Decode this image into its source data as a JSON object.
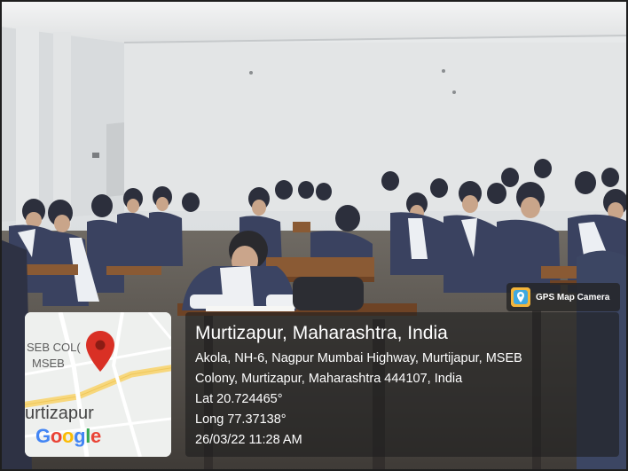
{
  "gps_badge": {
    "label": "GPS Map Camera",
    "icon": "gps-map-camera-icon"
  },
  "map": {
    "labels": [
      "SEB COL(",
      "MSEB",
      "urtizapur"
    ],
    "logo": "Google",
    "logo_colors": [
      "#4285f4",
      "#ea4335",
      "#fbbc05",
      "#4285f4",
      "#34a853",
      "#ea4335"
    ],
    "pin_color": "#d93025"
  },
  "location": {
    "title": "Murtizapur, Maharashtra, India",
    "address_line1": "Akola, NH-6, Nagpur Mumbai Highway, Murtijapur, MSEB",
    "address_line2": "Colony, Murtizapur, Maharashtra 444107, India",
    "lat": "Lat 20.724465°",
    "long": "Long 77.37138°",
    "datetime": "26/03/22 11:28 AM"
  }
}
